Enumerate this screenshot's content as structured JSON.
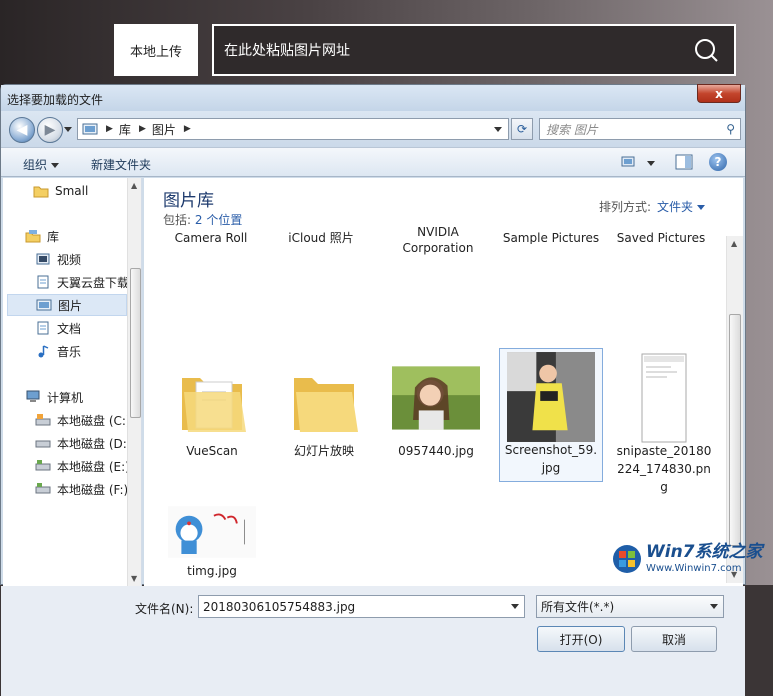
{
  "page": {
    "upload_tab_label": "本地上传",
    "url_placeholder": "在此处粘贴图片网址"
  },
  "dialog": {
    "title": "选择要加载的文件",
    "close_label": "x",
    "address": {
      "crumbs": [
        "库",
        "图片"
      ]
    },
    "search_placeholder": "搜索 图片",
    "toolbar": {
      "organize_label": "组织",
      "new_folder_label": "新建文件夹"
    },
    "nav": {
      "items": [
        {
          "label": "Small",
          "icon": "folder-icon"
        },
        {
          "label": "库",
          "icon": "library-icon"
        },
        {
          "label": "视频",
          "icon": "video-library-icon"
        },
        {
          "label": "天翼云盘下载",
          "icon": "document-icon"
        },
        {
          "label": "图片",
          "icon": "picture-library-icon",
          "selected": true
        },
        {
          "label": "文档",
          "icon": "document-library-icon"
        },
        {
          "label": "音乐",
          "icon": "music-library-icon"
        },
        {
          "label": "计算机",
          "icon": "computer-icon"
        },
        {
          "label": "本地磁盘 (C:)",
          "icon": "drive-icon"
        },
        {
          "label": "本地磁盘 (D:)",
          "icon": "drive-icon"
        },
        {
          "label": "本地磁盘 (E:)",
          "icon": "drive-icon"
        },
        {
          "label": "本地磁盘 (F:)",
          "icon": "drive-icon"
        }
      ]
    },
    "library": {
      "title": "图片库",
      "includes_prefix": "包括:",
      "includes_link": "2 个位置",
      "sort_prefix": "排列方式:",
      "sort_value": "文件夹"
    },
    "cut_labels": [
      "Camera Roll",
      "iCloud 照片",
      "NVIDIA Corporation",
      "Sample Pictures",
      "Saved Pictures"
    ],
    "files": [
      {
        "name": "VueScan",
        "kind": "folder"
      },
      {
        "name": "幻灯片放映",
        "kind": "folder"
      },
      {
        "name": "0957440.jpg",
        "kind": "photo"
      },
      {
        "name": "Screenshot_59.jpg",
        "kind": "photo",
        "selected": true
      },
      {
        "name": "snipaste_20180224_174830.png",
        "kind": "screenshot"
      },
      {
        "name": "timg.jpg",
        "kind": "cartoon"
      }
    ],
    "footer": {
      "filename_label": "文件名(N):",
      "filename_value": "20180306105754883.jpg",
      "filetype_value": "所有文件(*.*)",
      "open_label": "打开(O)",
      "cancel_label": "取消"
    }
  },
  "watermark": {
    "main": "Win7系统之家",
    "url": "Www.Winwin7.com"
  }
}
